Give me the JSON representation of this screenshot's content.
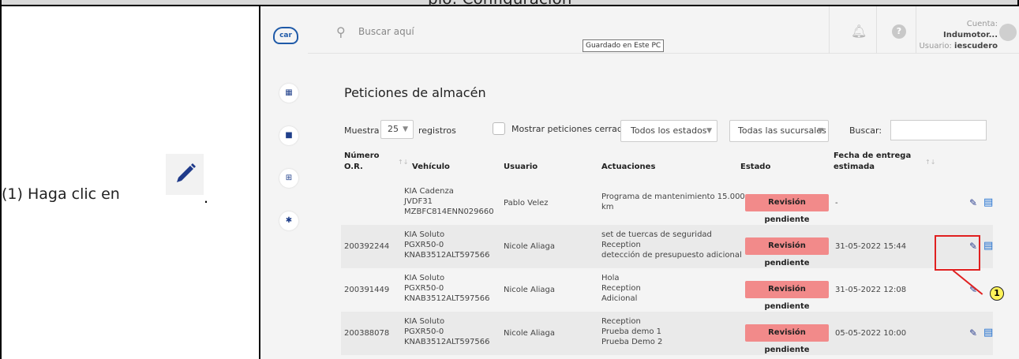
{
  "doc": {
    "header_text": "plo: Configuración",
    "instruction": "(1) Haga clic en",
    "instruction_end": "."
  },
  "app": {
    "logo": "car",
    "search_placeholder": "Buscar aquí",
    "tooltip": "Guardado en Este PC",
    "account_label": "Cuenta:",
    "account_value": "Indumotor...",
    "user_label": "Usuario:",
    "user_value": "iescudero"
  },
  "page": {
    "title": "Peticiones de almacén",
    "show_label": "Muestra",
    "show_value": "25",
    "records_label": "registros",
    "closed_checkbox_label": "Mostrar peticiones cerradas",
    "status_filter": "Todos los estados",
    "branch_filter": "Todas las sucursales",
    "search_label": "Buscar:"
  },
  "table": {
    "headers": {
      "or_line1": "Número",
      "or_line2": "O.R.",
      "vehicle": "Vehículo",
      "user": "Usuario",
      "actions": "Actuaciones",
      "status": "Estado",
      "delivery_line1": "Fecha de entrega",
      "delivery_line2": "estimada"
    },
    "rows": [
      {
        "or": "",
        "vehicle": [
          "KIA Cadenza",
          "JVDF31",
          "MZBFC814ENN029660"
        ],
        "user": "Pablo Velez",
        "actions": [
          "Programa de mantenimiento 15.000",
          "km"
        ],
        "status": "Revisión pendiente",
        "delivery": "-"
      },
      {
        "or": "200392244",
        "vehicle": [
          "KIA Soluto",
          "PGXR50-0",
          "KNAB3512ALT597566"
        ],
        "user": "Nicole Aliaga",
        "actions": [
          "set de tuercas de seguridad",
          "Reception",
          "detección de presupuesto adicional"
        ],
        "status": "Revisión pendiente",
        "delivery": "31-05-2022 15:44"
      },
      {
        "or": "200391449",
        "vehicle": [
          "KIA Soluto",
          "PGXR50-0",
          "KNAB3512ALT597566"
        ],
        "user": "Nicole Aliaga",
        "actions": [
          "Hola",
          "Reception",
          "Adicional"
        ],
        "status": "Revisión pendiente",
        "delivery": "31-05-2022 12:08"
      },
      {
        "or": "200388078",
        "vehicle": [
          "KIA Soluto",
          "PGXR50-0",
          "KNAB3512ALT597566"
        ],
        "user": "Nicole Aliaga",
        "actions": [
          "Reception",
          "Prueba demo 1",
          "Prueba Demo 2"
        ],
        "status": "Revisión pendiente",
        "delivery": "05-05-2022 10:00"
      }
    ]
  },
  "callout": {
    "number": "1"
  },
  "icons": {
    "logo": "cloud-car-logo-icon",
    "calendar": "calendar-icon",
    "document": "document-icon",
    "table": "table-icon",
    "settings": "gear-icon",
    "search": "search-icon",
    "bell": "bell-icon",
    "help": "help-icon",
    "edit": "pencil-icon",
    "detail": "list-icon"
  },
  "colors": {
    "status_badge": "#f28a8a",
    "highlight": "#e02020",
    "callout_fill": "#fff35a",
    "edit_icon": "#2a3e8f",
    "list_icon": "#1f6fd0"
  }
}
